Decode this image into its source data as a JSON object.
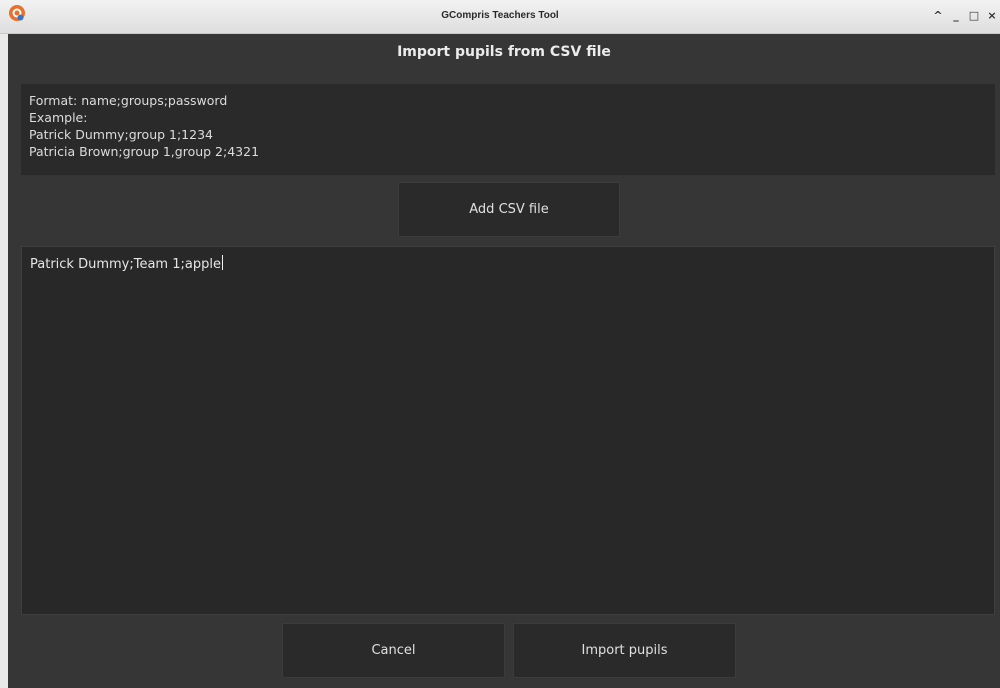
{
  "window": {
    "title": "GCompris Teachers Tool",
    "controls": {
      "minimize_up": "^",
      "minimize": "_",
      "maximize": "□",
      "close": "×"
    }
  },
  "dialog": {
    "title": "Import pupils from CSV file",
    "format_help": [
      "Format: name;groups;password",
      "Example:",
      "Patrick Dummy;group 1;1234",
      "Patricia Brown;group 1,group 2;4321"
    ],
    "add_button_label": "Add CSV file",
    "editor_text": "Patrick Dummy;Team 1;apple",
    "cancel_label": "Cancel",
    "import_label": "Import pupils"
  },
  "colors": {
    "background": "#363636",
    "panel": "#2a2a2a",
    "text": "#e0e0e0",
    "app_icon_orange": "#e8702a"
  },
  "icons": {
    "app": "gcompris-logo-icon"
  }
}
